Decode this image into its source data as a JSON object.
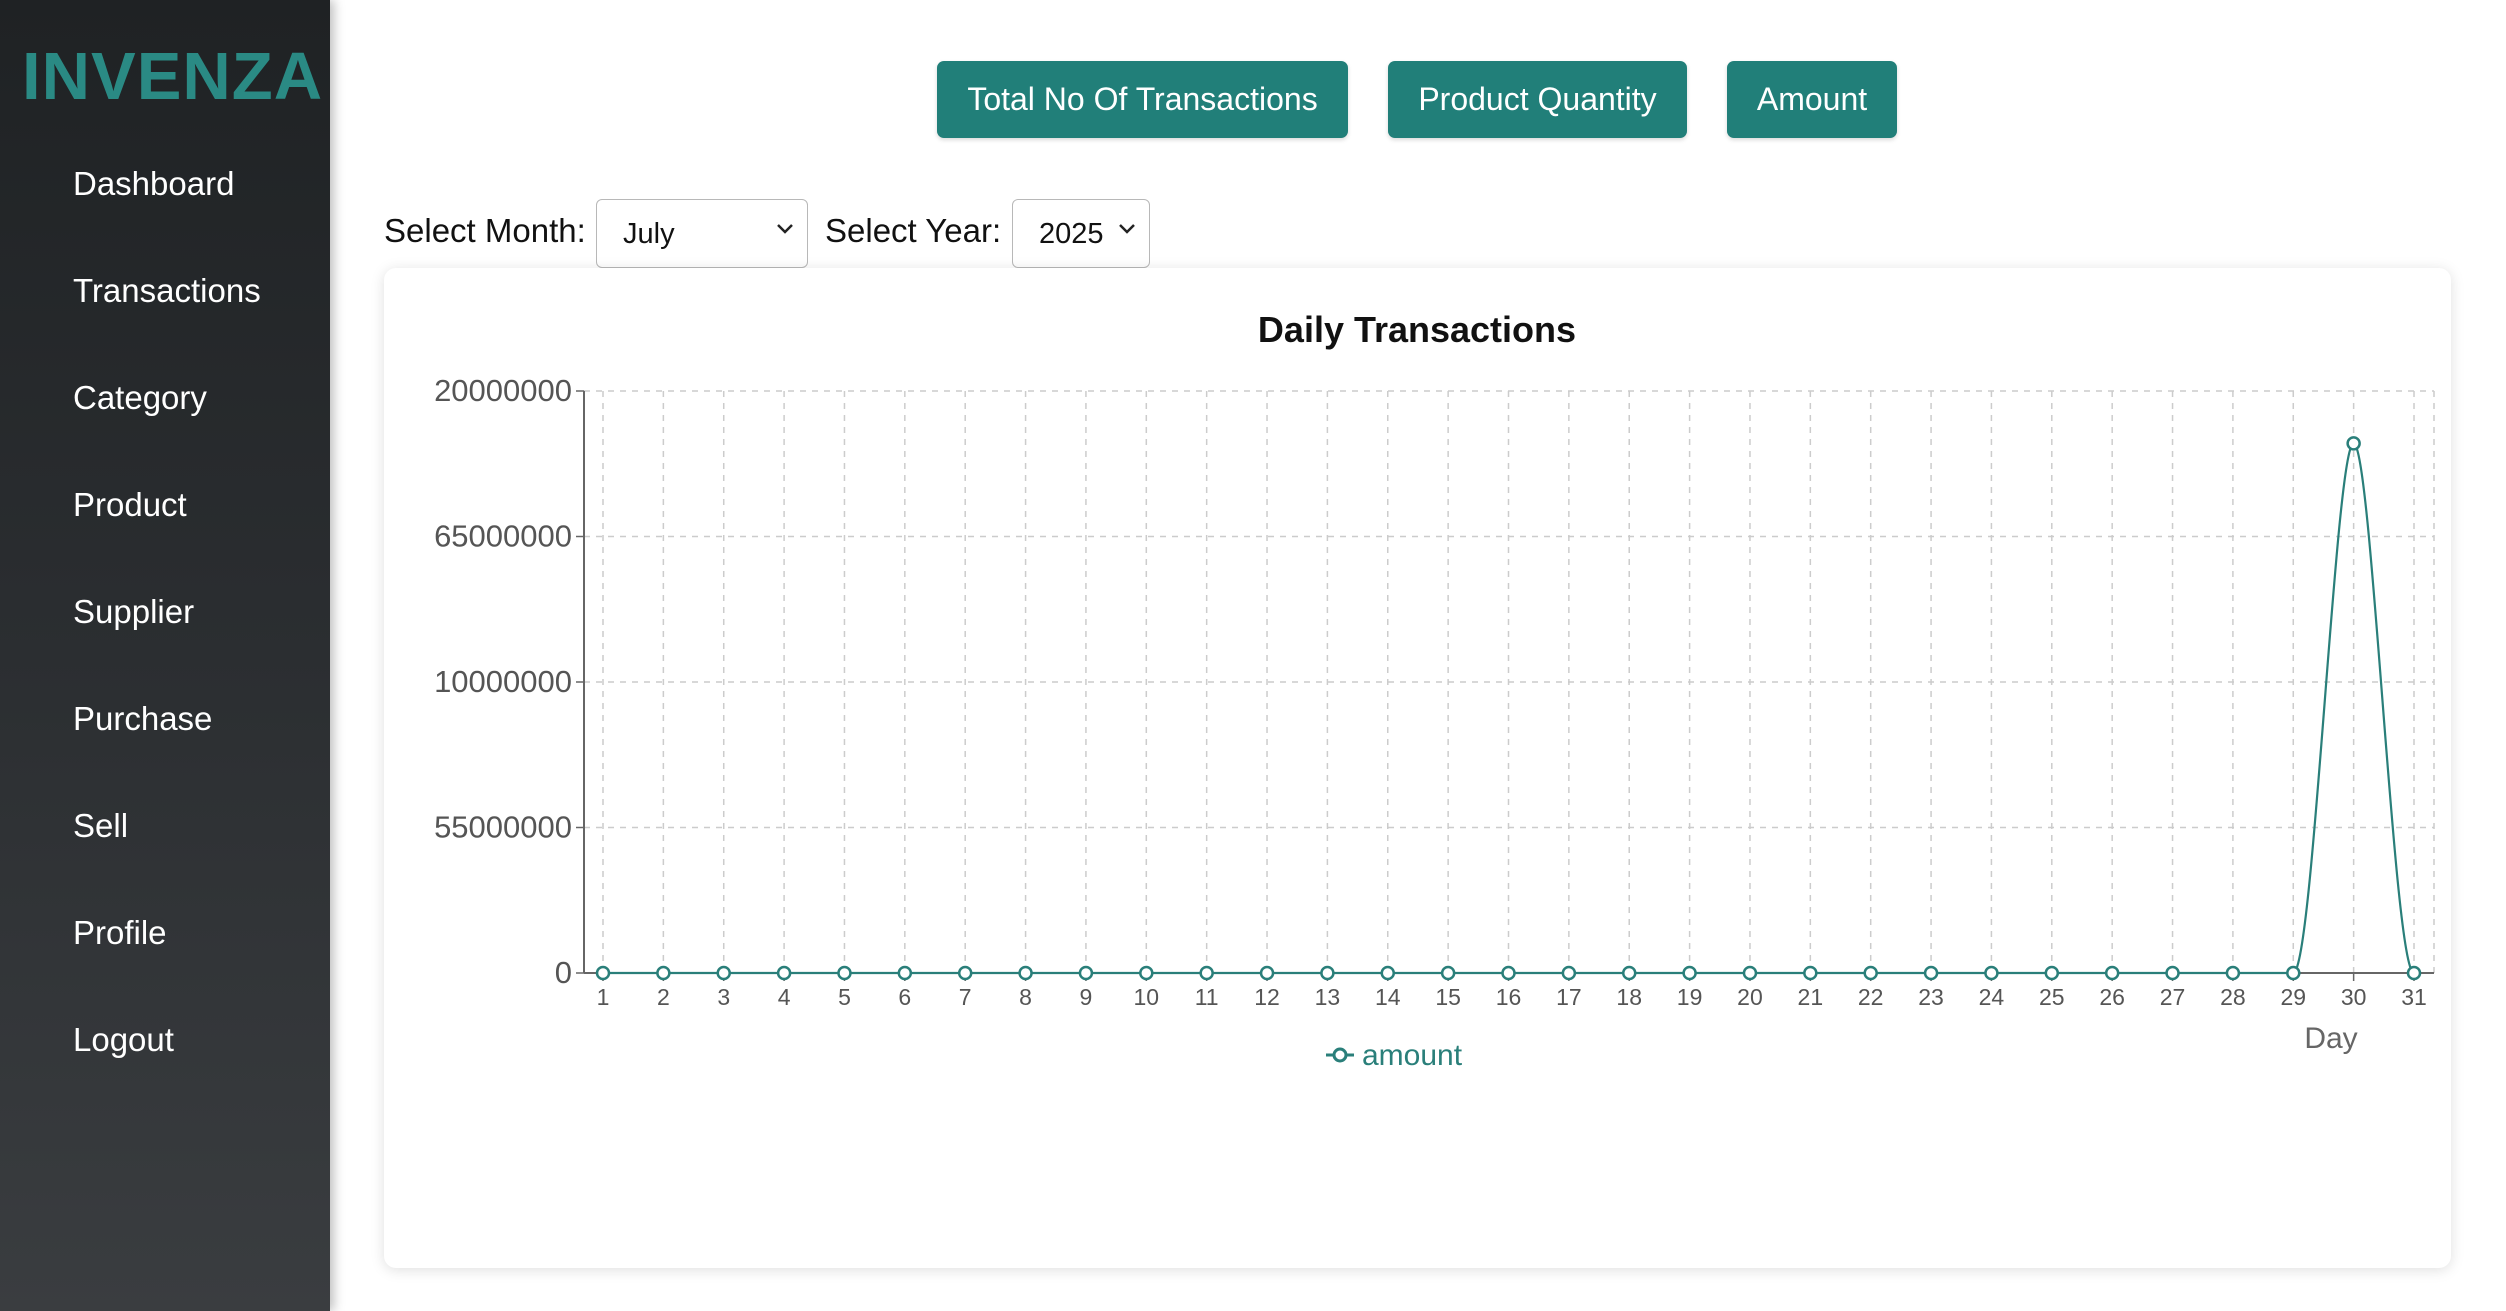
{
  "sidebar": {
    "brand": "INVENZA",
    "items": [
      {
        "label": "Dashboard"
      },
      {
        "label": "Transactions"
      },
      {
        "label": "Category"
      },
      {
        "label": "Product"
      },
      {
        "label": "Supplier"
      },
      {
        "label": "Purchase"
      },
      {
        "label": "Sell"
      },
      {
        "label": "Profile"
      },
      {
        "label": "Logout"
      }
    ]
  },
  "tabs": [
    {
      "label": "Total No Of Transactions"
    },
    {
      "label": "Product Quantity"
    },
    {
      "label": "Amount"
    }
  ],
  "filters": {
    "month_label": "Select Month:",
    "month_value": "July",
    "year_label": "Select Year:",
    "year_value": "2025"
  },
  "colors": {
    "accent": "#217f79",
    "series": "#2a7f7a"
  },
  "chart_data": {
    "type": "line",
    "title": "Daily Transactions",
    "xlabel": "Day",
    "ylabel": "",
    "x": [
      1,
      2,
      3,
      4,
      5,
      6,
      7,
      8,
      9,
      10,
      11,
      12,
      13,
      14,
      15,
      16,
      17,
      18,
      19,
      20,
      21,
      22,
      23,
      24,
      25,
      26,
      27,
      28,
      29,
      30,
      31
    ],
    "y_tick_labels": [
      "0",
      "55000000",
      "10000000",
      "65000000",
      "20000000"
    ],
    "ylim": [
      0,
      4
    ],
    "grid": true,
    "legend_position": "bottom",
    "series": [
      {
        "name": "amount",
        "values": [
          0,
          0,
          0,
          0,
          0,
          0,
          0,
          0,
          0,
          0,
          0,
          0,
          0,
          0,
          0,
          0,
          0,
          0,
          0,
          0,
          0,
          0,
          0,
          0,
          0,
          0,
          0,
          0,
          0,
          3.64,
          0
        ]
      }
    ]
  }
}
